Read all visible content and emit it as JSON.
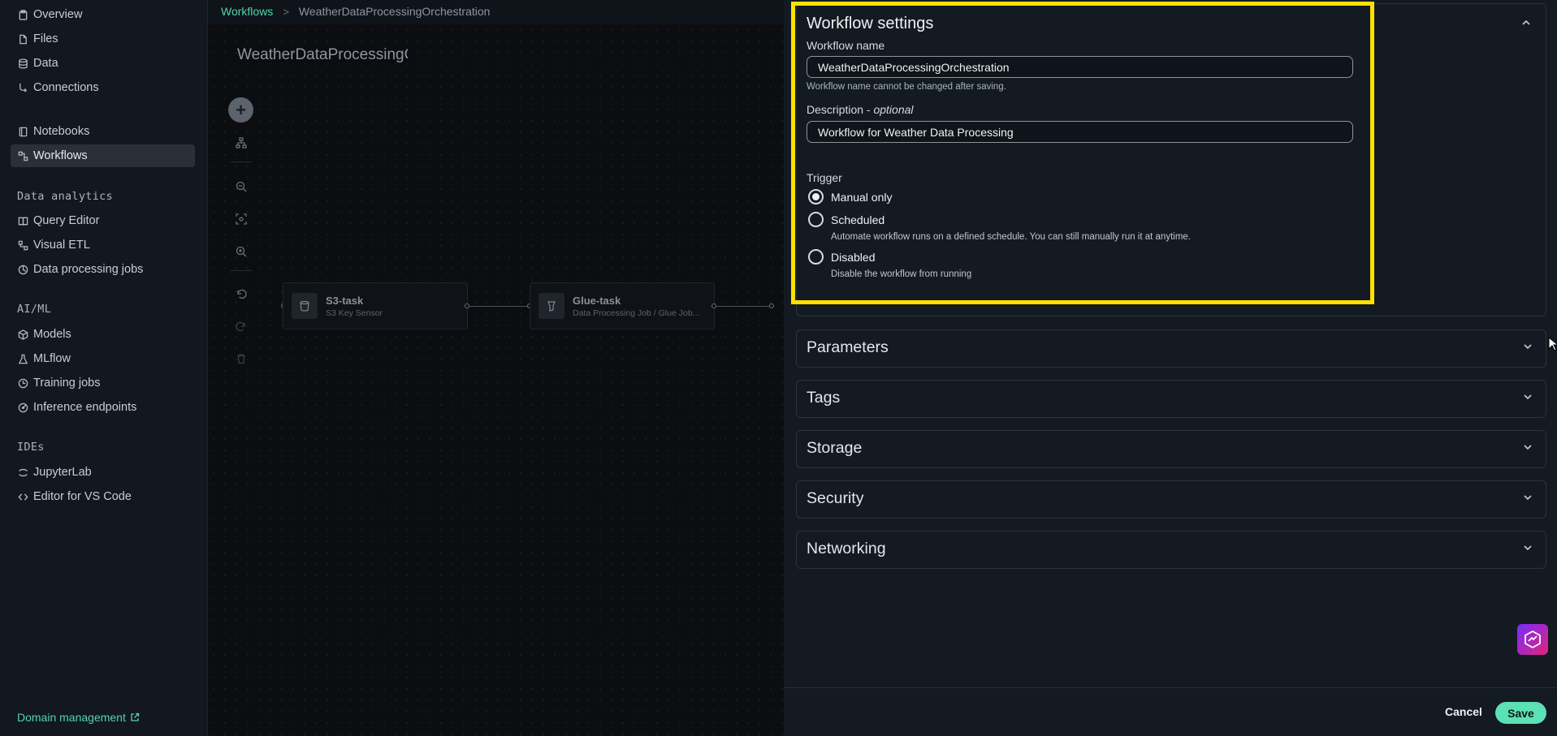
{
  "sidebar": {
    "items_top": [
      {
        "label": "Overview",
        "icon": "clipboard-icon"
      },
      {
        "label": "Files",
        "icon": "file-icon"
      },
      {
        "label": "Data",
        "icon": "database-icon"
      },
      {
        "label": "Connections",
        "icon": "connection-icon"
      }
    ],
    "items_mid": [
      {
        "label": "Notebooks",
        "icon": "notebook-icon"
      },
      {
        "label": "Workflows",
        "icon": "workflow-icon"
      }
    ],
    "section_analytics": "Data analytics",
    "items_analytics": [
      {
        "label": "Query Editor",
        "icon": "book-icon"
      },
      {
        "label": "Visual ETL",
        "icon": "etl-icon"
      },
      {
        "label": "Data processing jobs",
        "icon": "process-icon"
      }
    ],
    "section_aiml": "AI/ML",
    "items_aiml": [
      {
        "label": "Models",
        "icon": "cube-icon"
      },
      {
        "label": "MLflow",
        "icon": "flask-icon"
      },
      {
        "label": "Training jobs",
        "icon": "clock-icon"
      },
      {
        "label": "Inference endpoints",
        "icon": "endpoint-icon"
      }
    ],
    "section_ides": "IDEs",
    "items_ides": [
      {
        "label": "JupyterLab",
        "icon": "jupyter-icon"
      },
      {
        "label": "Editor for VS Code",
        "icon": "code-icon"
      }
    ],
    "domain_link": "Domain management"
  },
  "breadcrumb": {
    "root": "Workflows",
    "separator": ">",
    "current": "WeatherDataProcessingOrchestration"
  },
  "canvas": {
    "title": "WeatherDataProcessingOrchestration",
    "nodes": [
      {
        "title": "S3-task",
        "subtitle": "S3 Key Sensor"
      },
      {
        "title": "Glue-task",
        "subtitle": "Data Processing Job / Glue Job..."
      }
    ]
  },
  "panel": {
    "workflow_settings": {
      "title": "Workflow settings",
      "name_label": "Workflow name",
      "name_value": "WeatherDataProcessingOrchestration",
      "name_hint": "Workflow name cannot be changed after saving.",
      "desc_label": "Description - ",
      "desc_optional": "optional",
      "desc_value": "Workflow for Weather Data Processing",
      "trigger_label": "Trigger",
      "options": [
        {
          "label": "Manual only",
          "desc": "",
          "selected": true
        },
        {
          "label": "Scheduled",
          "desc": "Automate workflow runs on a defined schedule. You can still manually run it at anytime.",
          "selected": false
        },
        {
          "label": "Disabled",
          "desc": "Disable the workflow from running",
          "selected": false
        }
      ]
    },
    "sections": [
      "Parameters",
      "Tags",
      "Storage",
      "Security",
      "Networking"
    ],
    "cancel": "Cancel",
    "save": "Save"
  },
  "colors": {
    "accent": "#55d4a9",
    "highlight": "#ffe100",
    "save_button": "#5ce0b5"
  }
}
